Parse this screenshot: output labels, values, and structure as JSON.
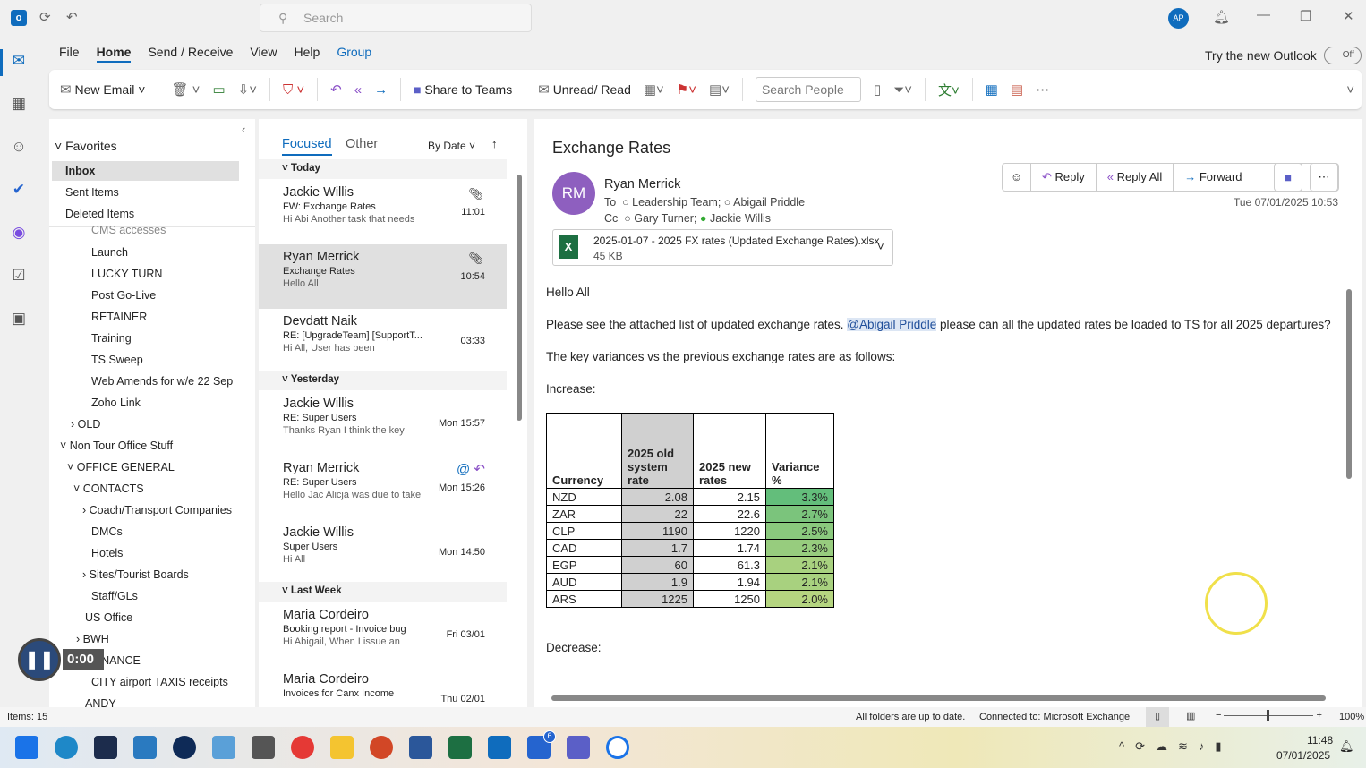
{
  "title_bar": {
    "search_placeholder": "Search",
    "avatar": "AP"
  },
  "menu": {
    "items": [
      "File",
      "Home",
      "Send / Receive",
      "View",
      "Help",
      "Group"
    ],
    "try_new": "Try the new Outlook",
    "toggle": "Off"
  },
  "ribbon": {
    "new_email": "New Email",
    "share_teams": "Share to Teams",
    "unread_read": "Unread/ Read",
    "search_people": "Search People"
  },
  "folders": {
    "favorites": "Favorites",
    "fav_items": [
      "Inbox",
      "Sent Items",
      "Deleted Items"
    ],
    "tree": [
      "CMS accesses",
      "Launch",
      "LUCKY TURN",
      "Post Go-Live",
      "RETAINER",
      "Training",
      "TS Sweep",
      "Web Amends for w/e 22 Sep",
      "Zoho Link",
      "OLD",
      "Non Tour Office Stuff",
      "OFFICE GENERAL",
      "CONTACTS",
      "Coach/Transport Companies",
      "DMCs",
      "Hotels",
      "Sites/Tourist Boards",
      "Staff/GLs",
      "US Office",
      "BWH",
      "FINANCE",
      "CITY airport TAXIS receipts",
      "ANDY"
    ]
  },
  "message_list": {
    "tabs": [
      "Focused",
      "Other"
    ],
    "sort": "By Date",
    "groups": [
      "Today",
      "Yesterday",
      "Last Week"
    ],
    "messages": [
      {
        "from": "Jackie Willis",
        "subject": "FW: Exchange Rates",
        "preview": "Hi Abi  Another task that needs",
        "time": "11:01"
      },
      {
        "from": "Ryan Merrick",
        "subject": "Exchange Rates",
        "preview": "Hello All",
        "time": "10:54"
      },
      {
        "from": "Devdatt Naik",
        "subject": "RE: [UpgradeTeam] [SupportT...",
        "preview": "Hi All,  User has been",
        "time": "03:33"
      },
      {
        "from": "Jackie Willis",
        "subject": "RE: Super Users",
        "preview": "Thanks Ryan  I think the key",
        "time": "Mon 15:57"
      },
      {
        "from": "Ryan Merrick",
        "subject": "RE: Super Users",
        "preview": "Hello Jac  Alicja was due to take",
        "time": "Mon 15:26"
      },
      {
        "from": "Jackie Willis",
        "subject": "Super Users",
        "preview": "Hi All",
        "time": "Mon 14:50"
      },
      {
        "from": "Maria Cordeiro",
        "subject": "Booking report - Invoice bug",
        "preview": "Hi Abigail,  When I issue an",
        "time": "Fri 03/01"
      },
      {
        "from": "Maria Cordeiro",
        "subject": "Invoices for Canx Income",
        "preview": "",
        "time": "Thu 02/01"
      }
    ]
  },
  "reading": {
    "subject": "Exchange Rates",
    "initials": "RM",
    "sender": "Ryan Merrick",
    "to_label": "To",
    "to": [
      "Leadership Team;",
      "Abigail Priddle"
    ],
    "cc_label": "Cc",
    "cc": [
      "Gary Turner;",
      "Jackie Willis"
    ],
    "date": "Tue 07/01/2025 10:53",
    "actions": {
      "reply": "Reply",
      "reply_all": "Reply All",
      "forward": "Forward"
    },
    "attachment": {
      "name": "2025-01-07 - 2025  FX rates (Updated Exchange Rates).xlsx",
      "size": "45 KB"
    },
    "body": {
      "greeting": "Hello All",
      "p1_pre": "Please see the attached list of updated exchange rates.",
      "mention": "@Abigail Priddle",
      "p1_post": "please can all the updated rates be loaded to TS for all 2025 departures?",
      "p2": "The key variances vs the previous exchange rates are as follows:",
      "increase": "Increase:",
      "decrease": "Decrease:"
    },
    "table": {
      "headers": [
        "Currency",
        "2025 old system rate",
        "2025 new rates",
        "Variance %"
      ],
      "rows": [
        [
          "NZD",
          "2.08",
          "2.15",
          "3.3%"
        ],
        [
          "ZAR",
          "22",
          "22.6",
          "2.7%"
        ],
        [
          "CLP",
          "1190",
          "1220",
          "2.5%"
        ],
        [
          "CAD",
          "1.7",
          "1.74",
          "2.3%"
        ],
        [
          "EGP",
          "60",
          "61.3",
          "2.1%"
        ],
        [
          "AUD",
          "1.9",
          "1.94",
          "2.1%"
        ],
        [
          "ARS",
          "1225",
          "1250",
          "2.0%"
        ]
      ]
    }
  },
  "recording": {
    "time": "0:00"
  },
  "status_bar": {
    "items": "Items: 15",
    "sync": "All folders are up to date.",
    "connection": "Connected to: Microsoft Exchange",
    "zoom": "100%"
  },
  "taskbar": {
    "time": "11:48",
    "date": "07/01/2025",
    "todo_badge": "6"
  }
}
